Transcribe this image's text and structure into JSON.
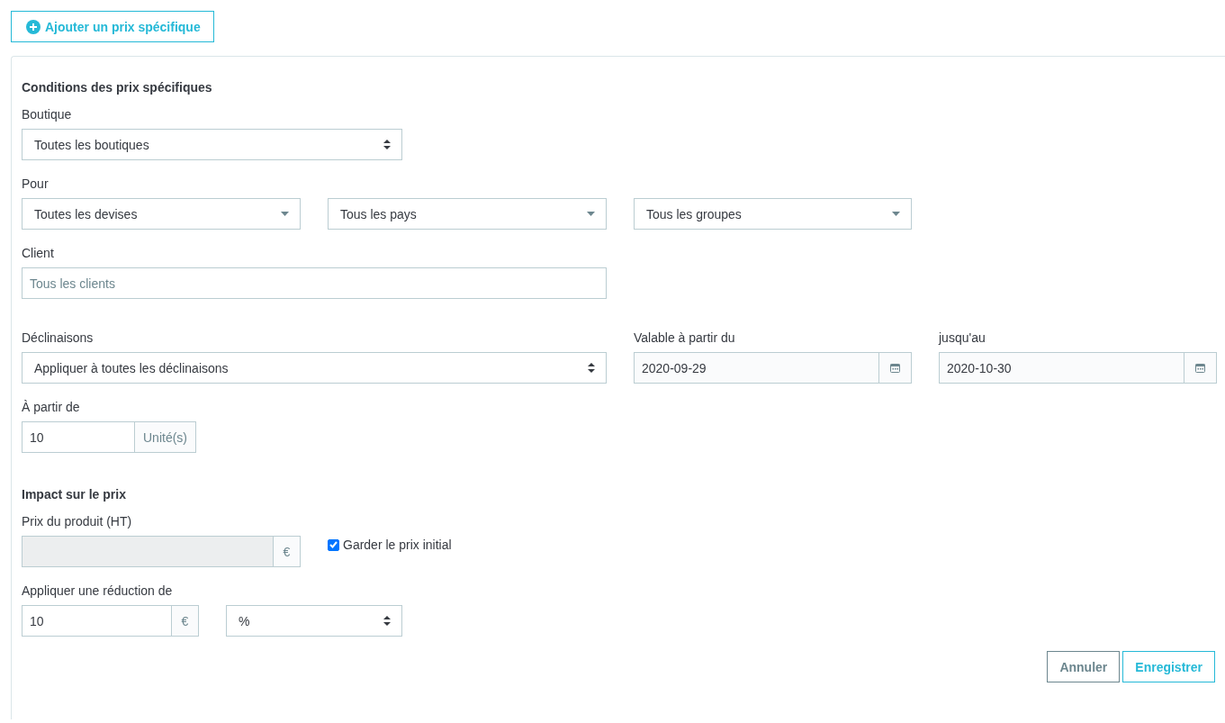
{
  "add_button": {
    "label": "Ajouter un prix spécifique"
  },
  "conditions": {
    "title": "Conditions des prix spécifiques",
    "shop": {
      "label": "Boutique",
      "value": "Toutes les boutiques"
    },
    "for": {
      "label": "Pour",
      "selects": [
        {
          "value": "Toutes les devises"
        },
        {
          "value": "Tous les pays"
        },
        {
          "value": "Tous les groupes"
        }
      ]
    },
    "customer": {
      "label": "Client",
      "placeholder": "Tous les clients"
    },
    "combinations": {
      "label": "Déclinaisons",
      "value": "Appliquer à toutes les déclinaisons"
    },
    "from_date": {
      "label": "Valable à partir du",
      "value": "2020-09-29"
    },
    "to_date": {
      "label": "jusqu'au",
      "value": "2020-10-30"
    },
    "from_quantity": {
      "label": "À partir de",
      "value": "10",
      "unit": "Unité(s)"
    }
  },
  "impact": {
    "title": "Impact sur le prix",
    "price": {
      "label": "Prix du produit (HT)",
      "unit": "€",
      "disabled": true
    },
    "keep_initial": {
      "label": "Garder le prix initial",
      "checked": true
    },
    "reduction": {
      "label": "Appliquer une réduction de",
      "value": "10",
      "unit": "€",
      "type": "%"
    }
  },
  "buttons": [
    {
      "label": "Annuler",
      "kind": "secondary"
    },
    {
      "label": "Enregistrer",
      "kind": "primary"
    }
  ]
}
